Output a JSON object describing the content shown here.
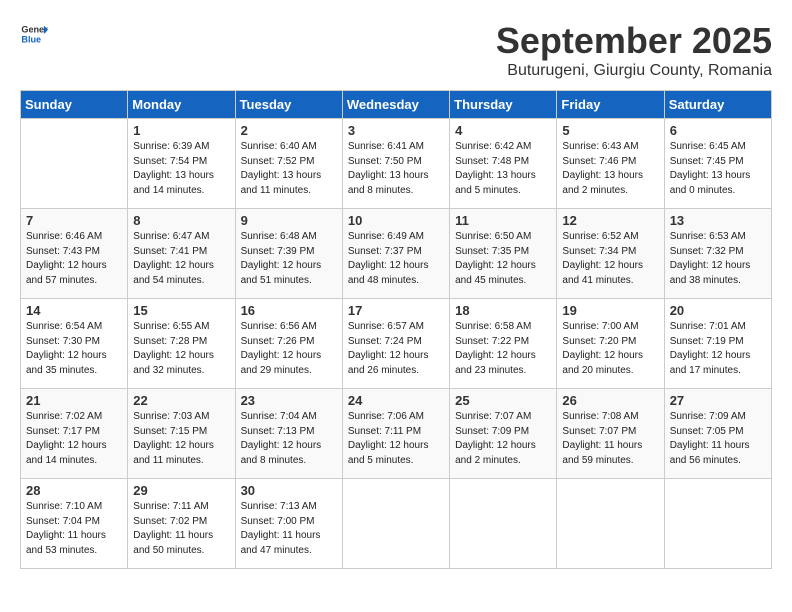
{
  "header": {
    "logo_general": "General",
    "logo_blue": "Blue",
    "month": "September 2025",
    "location": "Buturugeni, Giurgiu County, Romania"
  },
  "days_of_week": [
    "Sunday",
    "Monday",
    "Tuesday",
    "Wednesday",
    "Thursday",
    "Friday",
    "Saturday"
  ],
  "weeks": [
    [
      {
        "day": "",
        "info": ""
      },
      {
        "day": "1",
        "info": "Sunrise: 6:39 AM\nSunset: 7:54 PM\nDaylight: 13 hours\nand 14 minutes."
      },
      {
        "day": "2",
        "info": "Sunrise: 6:40 AM\nSunset: 7:52 PM\nDaylight: 13 hours\nand 11 minutes."
      },
      {
        "day": "3",
        "info": "Sunrise: 6:41 AM\nSunset: 7:50 PM\nDaylight: 13 hours\nand 8 minutes."
      },
      {
        "day": "4",
        "info": "Sunrise: 6:42 AM\nSunset: 7:48 PM\nDaylight: 13 hours\nand 5 minutes."
      },
      {
        "day": "5",
        "info": "Sunrise: 6:43 AM\nSunset: 7:46 PM\nDaylight: 13 hours\nand 2 minutes."
      },
      {
        "day": "6",
        "info": "Sunrise: 6:45 AM\nSunset: 7:45 PM\nDaylight: 13 hours\nand 0 minutes."
      }
    ],
    [
      {
        "day": "7",
        "info": "Sunrise: 6:46 AM\nSunset: 7:43 PM\nDaylight: 12 hours\nand 57 minutes."
      },
      {
        "day": "8",
        "info": "Sunrise: 6:47 AM\nSunset: 7:41 PM\nDaylight: 12 hours\nand 54 minutes."
      },
      {
        "day": "9",
        "info": "Sunrise: 6:48 AM\nSunset: 7:39 PM\nDaylight: 12 hours\nand 51 minutes."
      },
      {
        "day": "10",
        "info": "Sunrise: 6:49 AM\nSunset: 7:37 PM\nDaylight: 12 hours\nand 48 minutes."
      },
      {
        "day": "11",
        "info": "Sunrise: 6:50 AM\nSunset: 7:35 PM\nDaylight: 12 hours\nand 45 minutes."
      },
      {
        "day": "12",
        "info": "Sunrise: 6:52 AM\nSunset: 7:34 PM\nDaylight: 12 hours\nand 41 minutes."
      },
      {
        "day": "13",
        "info": "Sunrise: 6:53 AM\nSunset: 7:32 PM\nDaylight: 12 hours\nand 38 minutes."
      }
    ],
    [
      {
        "day": "14",
        "info": "Sunrise: 6:54 AM\nSunset: 7:30 PM\nDaylight: 12 hours\nand 35 minutes."
      },
      {
        "day": "15",
        "info": "Sunrise: 6:55 AM\nSunset: 7:28 PM\nDaylight: 12 hours\nand 32 minutes."
      },
      {
        "day": "16",
        "info": "Sunrise: 6:56 AM\nSunset: 7:26 PM\nDaylight: 12 hours\nand 29 minutes."
      },
      {
        "day": "17",
        "info": "Sunrise: 6:57 AM\nSunset: 7:24 PM\nDaylight: 12 hours\nand 26 minutes."
      },
      {
        "day": "18",
        "info": "Sunrise: 6:58 AM\nSunset: 7:22 PM\nDaylight: 12 hours\nand 23 minutes."
      },
      {
        "day": "19",
        "info": "Sunrise: 7:00 AM\nSunset: 7:20 PM\nDaylight: 12 hours\nand 20 minutes."
      },
      {
        "day": "20",
        "info": "Sunrise: 7:01 AM\nSunset: 7:19 PM\nDaylight: 12 hours\nand 17 minutes."
      }
    ],
    [
      {
        "day": "21",
        "info": "Sunrise: 7:02 AM\nSunset: 7:17 PM\nDaylight: 12 hours\nand 14 minutes."
      },
      {
        "day": "22",
        "info": "Sunrise: 7:03 AM\nSunset: 7:15 PM\nDaylight: 12 hours\nand 11 minutes."
      },
      {
        "day": "23",
        "info": "Sunrise: 7:04 AM\nSunset: 7:13 PM\nDaylight: 12 hours\nand 8 minutes."
      },
      {
        "day": "24",
        "info": "Sunrise: 7:06 AM\nSunset: 7:11 PM\nDaylight: 12 hours\nand 5 minutes."
      },
      {
        "day": "25",
        "info": "Sunrise: 7:07 AM\nSunset: 7:09 PM\nDaylight: 12 hours\nand 2 minutes."
      },
      {
        "day": "26",
        "info": "Sunrise: 7:08 AM\nSunset: 7:07 PM\nDaylight: 11 hours\nand 59 minutes."
      },
      {
        "day": "27",
        "info": "Sunrise: 7:09 AM\nSunset: 7:05 PM\nDaylight: 11 hours\nand 56 minutes."
      }
    ],
    [
      {
        "day": "28",
        "info": "Sunrise: 7:10 AM\nSunset: 7:04 PM\nDaylight: 11 hours\nand 53 minutes."
      },
      {
        "day": "29",
        "info": "Sunrise: 7:11 AM\nSunset: 7:02 PM\nDaylight: 11 hours\nand 50 minutes."
      },
      {
        "day": "30",
        "info": "Sunrise: 7:13 AM\nSunset: 7:00 PM\nDaylight: 11 hours\nand 47 minutes."
      },
      {
        "day": "",
        "info": ""
      },
      {
        "day": "",
        "info": ""
      },
      {
        "day": "",
        "info": ""
      },
      {
        "day": "",
        "info": ""
      }
    ]
  ]
}
